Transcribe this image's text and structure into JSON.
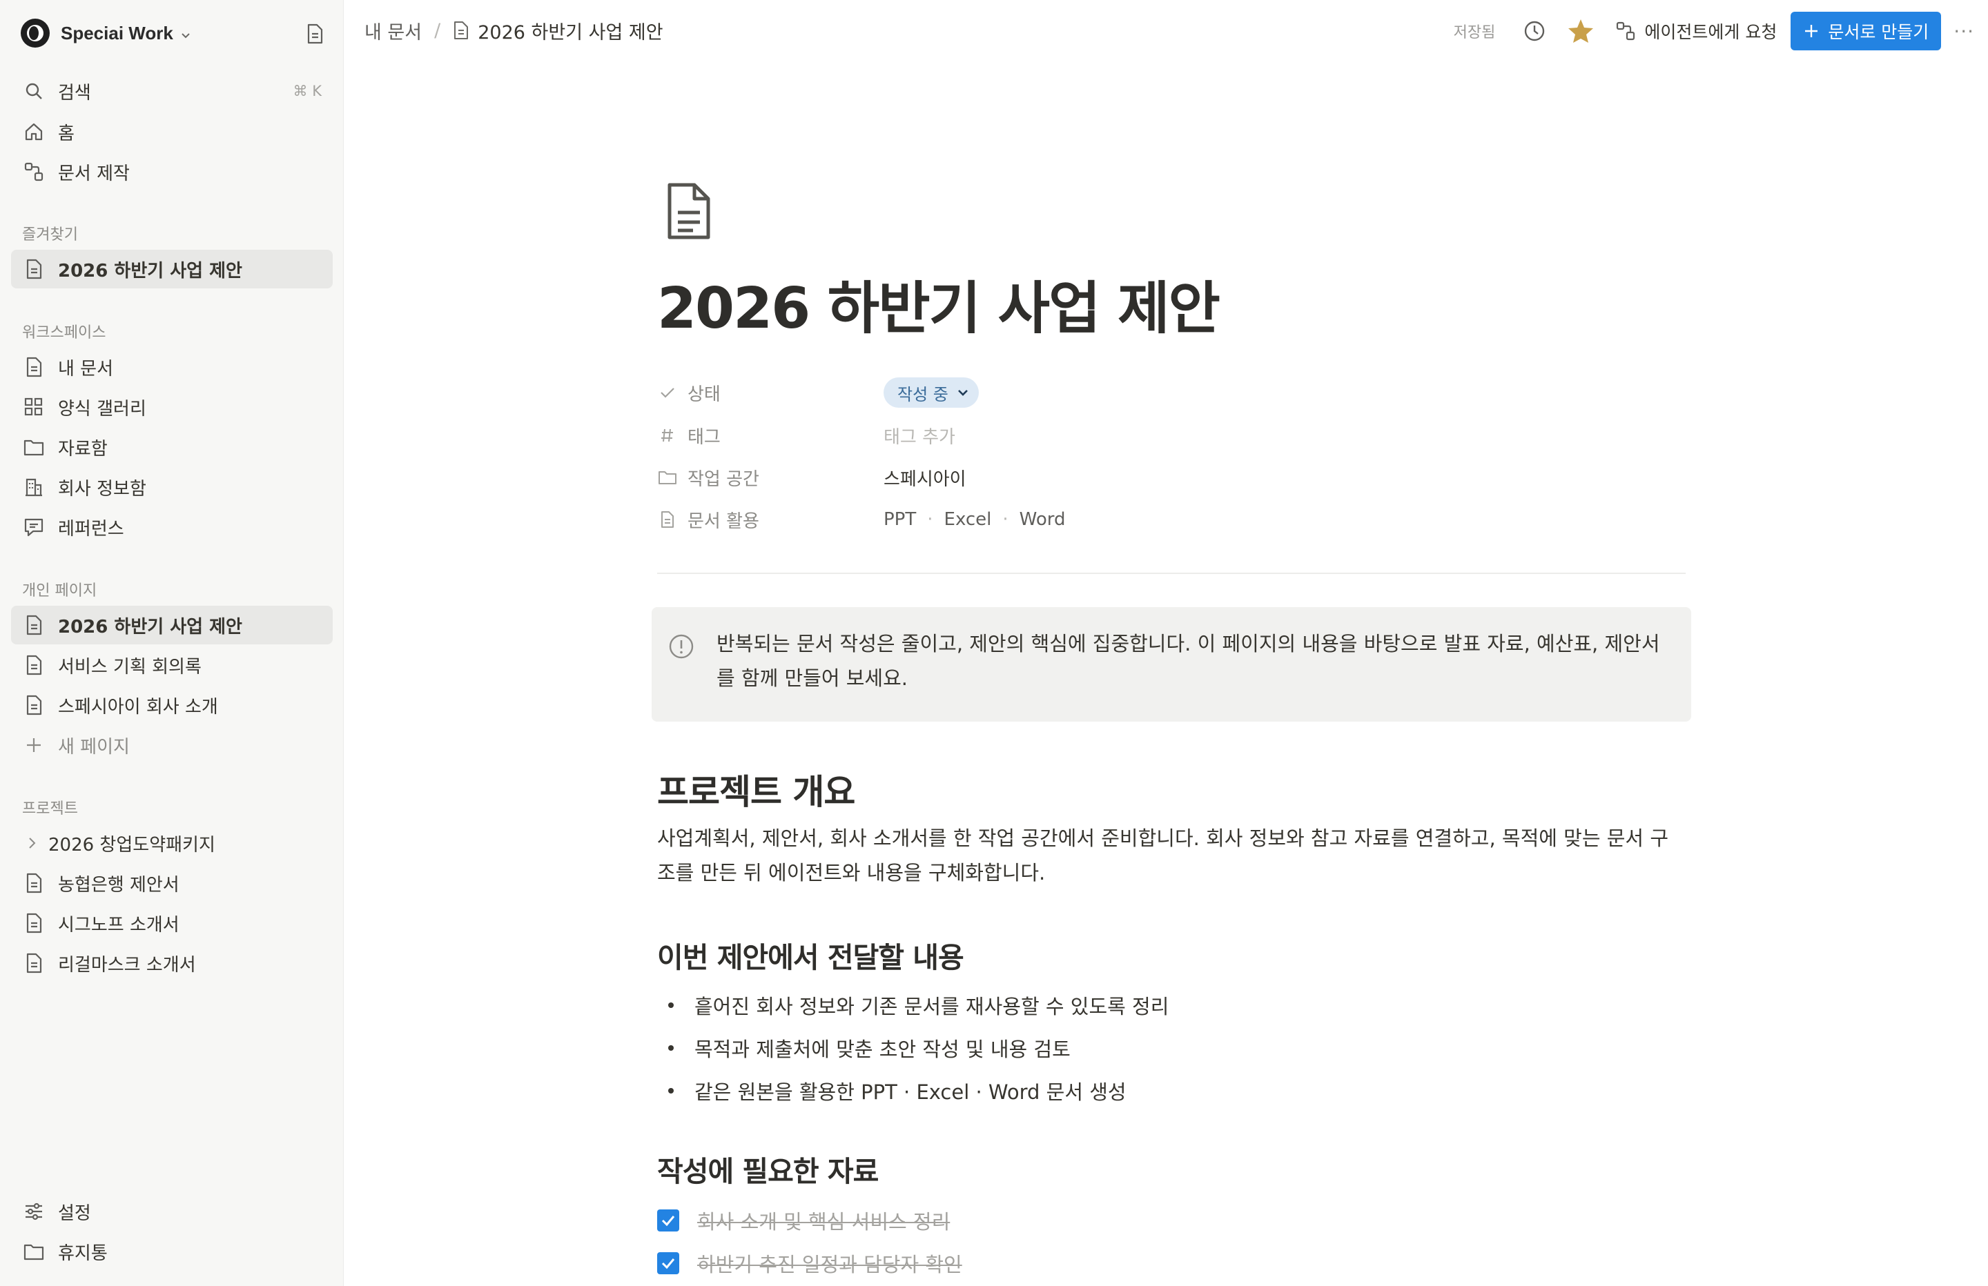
{
  "workspace": {
    "name": "Speciai Work"
  },
  "sidebar": {
    "top": [
      {
        "label": "검색",
        "shortcut": "⌘ K"
      },
      {
        "label": "홈"
      },
      {
        "label": "문서 제작"
      }
    ],
    "favorites_label": "즐겨찾기",
    "favorites": [
      {
        "label": "2026 하반기 사업 제안"
      }
    ],
    "workspace_label": "워크스페이스",
    "workspace_items": [
      {
        "label": "내 문서"
      },
      {
        "label": "양식 갤러리"
      },
      {
        "label": "자료함"
      },
      {
        "label": "회사 정보함"
      },
      {
        "label": "레퍼런스"
      }
    ],
    "personal_label": "개인 페이지",
    "personal_items": [
      {
        "label": "2026 하반기 사업 제안"
      },
      {
        "label": "서비스 기획 회의록"
      },
      {
        "label": "스페시아이 회사 소개"
      }
    ],
    "new_page": "새 페이지",
    "projects_label": "프로젝트",
    "projects": [
      {
        "label": "2026 창업도약패키지"
      },
      {
        "label": "농협은행 제안서"
      },
      {
        "label": "시그노프 소개서"
      },
      {
        "label": "리걸마스크 소개서"
      }
    ],
    "bottom": [
      {
        "label": "설정"
      },
      {
        "label": "휴지통"
      }
    ]
  },
  "topbar": {
    "breadcrumb_root": "내 문서",
    "breadcrumb_sep": "/",
    "breadcrumb_current": "2026 하반기 사업 제안",
    "saved": "저장됨",
    "agent_request": "에이전트에게 요청",
    "make_doc": "문서로 만들기",
    "more": "···"
  },
  "doc": {
    "title": "2026 하반기 사업 제안",
    "properties": {
      "status": {
        "name": "상태",
        "value": "작성 중"
      },
      "tags": {
        "name": "태그",
        "value": "태그 추가"
      },
      "space": {
        "name": "작업 공간",
        "value": "스페시아이"
      },
      "usage": {
        "name": "문서 활용",
        "values": [
          "PPT",
          "Excel",
          "Word"
        ],
        "sep": "·"
      }
    },
    "callout": "반복되는 문서 작성은 줄이고, 제안의 핵심에 집중합니다. 이 페이지의 내용을 바탕으로 발표 자료, 예산표, 제안서를 함께 만들어 보세요.",
    "overview_heading": "프로젝트 개요",
    "overview_text": "사업계획서, 제안서, 회사 소개서를 한 작업 공간에서 준비합니다. 회사 정보와 참고 자료를 연결하고, 목적에 맞는 문서 구조를 만든 뒤 에이전트와 내용을 구체화합니다.",
    "deliver_heading": "이번 제안에서 전달할 내용",
    "deliver_items": [
      "흩어진 회사 정보와 기존 문서를 재사용할 수 있도록 정리",
      "목적과 제출처에 맞춘 초안 작성 및 내용 검토",
      "같은 원본을 활용한 PPT · Excel · Word 문서 생성"
    ],
    "materials_heading": "작성에 필요한 자료",
    "materials": [
      {
        "label": "회사 소개 및 핵심 서비스 정리",
        "checked": true
      },
      {
        "label": "하반기 추진 일정과 담당자 확인",
        "checked": true
      }
    ]
  },
  "colors": {
    "accent": "#2383e2",
    "star": "#c9a04a",
    "pill_bg": "#dde9f5",
    "sidebar_bg": "#f7f7f5"
  }
}
